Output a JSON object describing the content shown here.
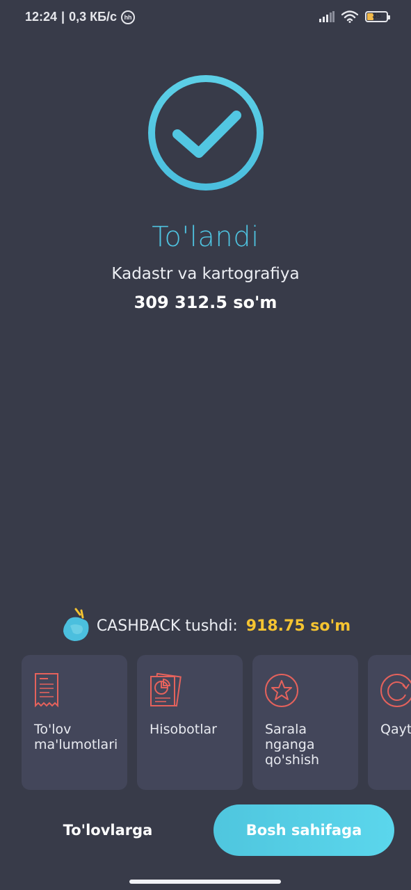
{
  "status_bar": {
    "time": "12:24",
    "separator": "|",
    "network_speed": "0,3 КБ/с",
    "hh_badge": "hh",
    "battery_level": "35",
    "battery_fraction": 0.35,
    "icons": [
      "signal-icon",
      "wifi-icon",
      "battery-icon"
    ]
  },
  "result": {
    "icon": "checkmark-circle-icon",
    "title": "To'landi",
    "merchant": "Kadastr va kartografiya",
    "amount": "309 312.5 so'm"
  },
  "cashback": {
    "icon": "cashback-wallet-icon",
    "label": "CASHBACK tushdi:",
    "value": "918.75 so'm"
  },
  "actions": [
    {
      "label": "To'lov\nma'lumotlari",
      "icon": "receipt-icon"
    },
    {
      "label": "Hisobotlar",
      "icon": "reports-icon"
    },
    {
      "label": "Sarala\nnganga\nqo'shish",
      "icon": "star-icon"
    },
    {
      "label": "Qayt",
      "icon": "repeat-icon"
    }
  ],
  "buttons": {
    "secondary": "To'lovlarga",
    "primary": "Bosh sahifaga"
  },
  "colors": {
    "background": "#383b49",
    "card": "#43465a",
    "accent": "#4fc3e0",
    "icon_red": "#e5625c",
    "cashback_yellow": "#f5c431"
  }
}
